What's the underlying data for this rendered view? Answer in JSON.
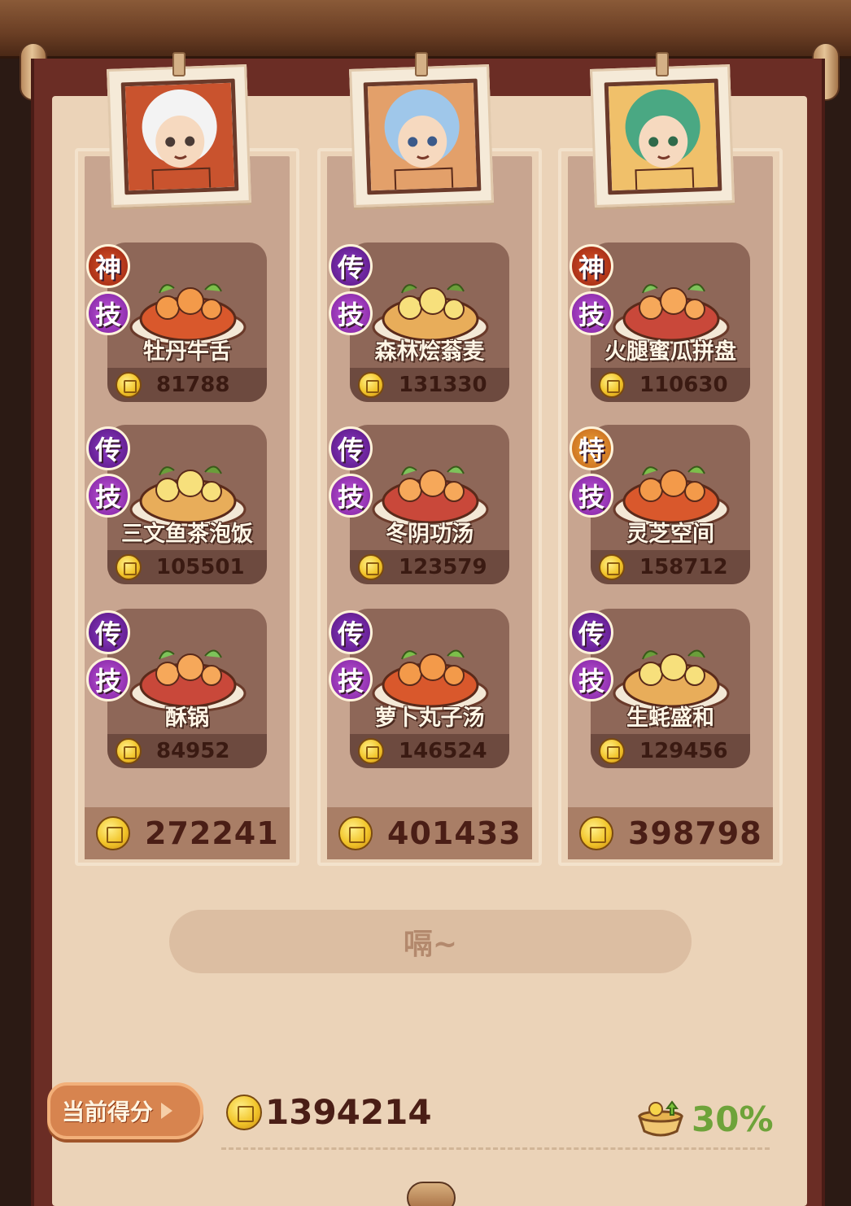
{
  "columns": [
    {
      "chef": "chef-1",
      "total": "272241",
      "dishes": [
        {
          "badges": [
            "神",
            "技"
          ],
          "badge_types": [
            "god",
            "skill"
          ],
          "name": "牡丹牛舌",
          "price": "81788"
        },
        {
          "badges": [
            "传",
            "技"
          ],
          "badge_types": [
            "leg",
            "skill"
          ],
          "name": "三文鱼茶泡饭",
          "price": "105501"
        },
        {
          "badges": [
            "传",
            "技"
          ],
          "badge_types": [
            "leg",
            "skill"
          ],
          "name": "酥锅",
          "price": "84952"
        }
      ]
    },
    {
      "chef": "chef-2",
      "total": "401433",
      "dishes": [
        {
          "badges": [
            "传",
            "技"
          ],
          "badge_types": [
            "leg",
            "skill"
          ],
          "name": "森林烩蓊麦",
          "price": "131330"
        },
        {
          "badges": [
            "传",
            "技"
          ],
          "badge_types": [
            "leg",
            "skill"
          ],
          "name": "冬阴功汤",
          "price": "123579"
        },
        {
          "badges": [
            "传",
            "技"
          ],
          "badge_types": [
            "leg",
            "skill"
          ],
          "name": "萝卜丸子汤",
          "price": "146524"
        }
      ]
    },
    {
      "chef": "chef-3",
      "total": "398798",
      "dishes": [
        {
          "badges": [
            "神",
            "技"
          ],
          "badge_types": [
            "god",
            "skill"
          ],
          "name": "火腿蜜瓜拼盘",
          "price": "110630"
        },
        {
          "badges": [
            "特",
            "技"
          ],
          "badge_types": [
            "spec",
            "skill"
          ],
          "name": "灵芝空间",
          "price": "158712"
        },
        {
          "badges": [
            "传",
            "技"
          ],
          "badge_types": [
            "leg",
            "skill"
          ],
          "name": "生蚝盛和",
          "price": "129456"
        }
      ]
    }
  ],
  "hum_button": "嗝~",
  "score_label": "当前得分",
  "total_score": "1394214",
  "satiety_percent": "30%",
  "colors": {
    "accent": "#d7844f",
    "satiety": "#6ea33a",
    "frame": "#6b2d25",
    "paper": "#ebd3b8"
  }
}
